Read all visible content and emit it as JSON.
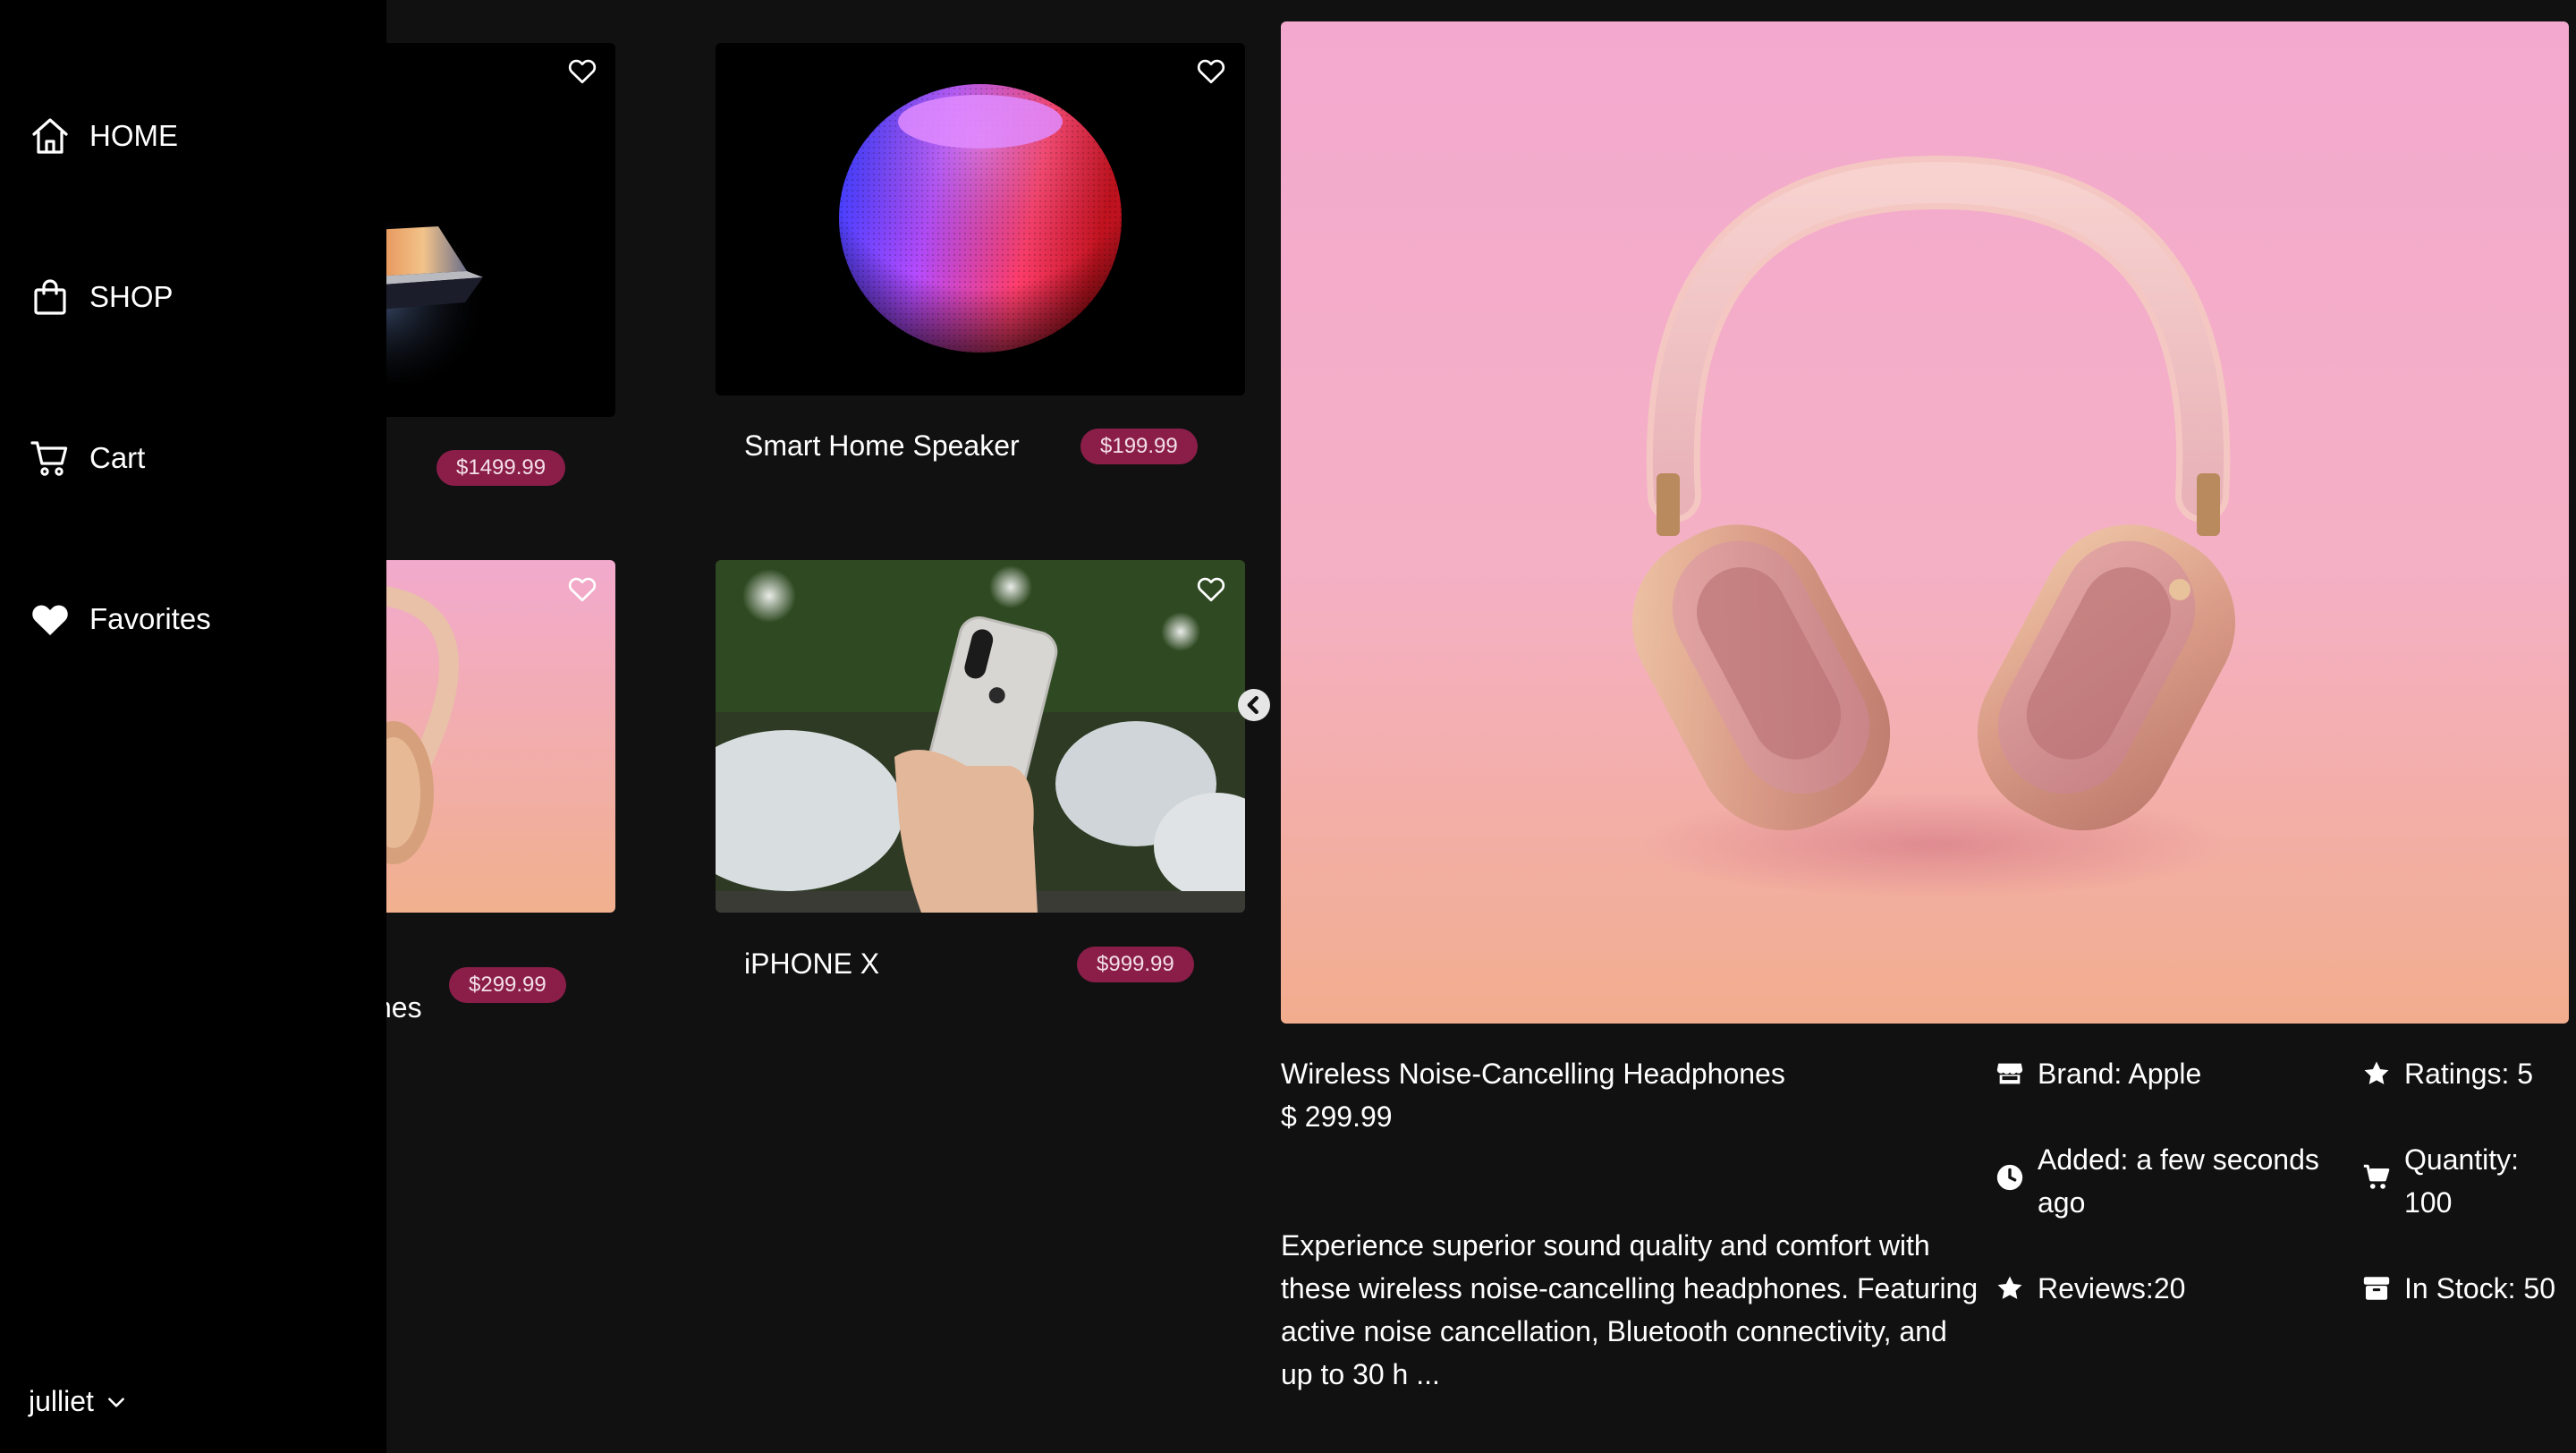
{
  "sidebar": {
    "items": [
      {
        "label": "HOME",
        "icon": "home-icon"
      },
      {
        "label": "SHOP",
        "icon": "shopping-bag-icon"
      },
      {
        "label": "Cart",
        "icon": "cart-icon"
      },
      {
        "label": "Favorites",
        "icon": "heart-icon"
      }
    ],
    "user": "julliet"
  },
  "products": [
    {
      "name": "",
      "price": "$1499.99",
      "image": "laptop-image"
    },
    {
      "name": "Smart Home Speaker",
      "price": "$199.99",
      "image": "smart-speaker-image"
    },
    {
      "name": "nes",
      "price": "$299.99",
      "image": "headphones-image"
    },
    {
      "name": "iPHONE X",
      "price": "$999.99",
      "image": "iphone-image"
    }
  ],
  "detail": {
    "title": "Wireless Noise-Cancelling Headphones",
    "price": "$ 299.99",
    "brand": "Brand: Apple",
    "ratings": "Ratings: 5",
    "added_line1": "Added: a few seconds",
    "added_line2": "ago",
    "quantity_line1": "Quantity:",
    "quantity_line2": "100",
    "reviews": "Reviews:20",
    "in_stock": "In Stock: 50",
    "description_lines": [
      "Experience superior sound quality and comfort with",
      "these wireless noise-cancelling headphones. Featuring",
      "active noise cancellation, Bluetooth connectivity, and",
      "up to 30 h ..."
    ]
  },
  "colors": {
    "background": "#111111",
    "sidebar": "#000000",
    "price_badge": "#8b1e49",
    "text": "#ffffff"
  }
}
